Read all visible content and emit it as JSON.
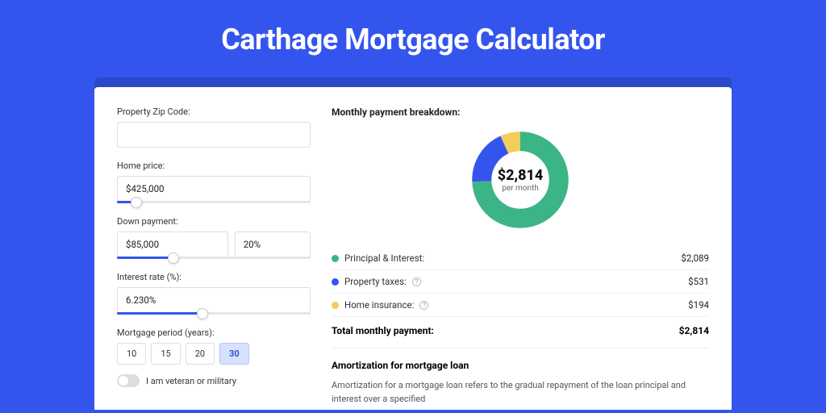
{
  "page_title": "Carthage Mortgage Calculator",
  "form": {
    "zip_label": "Property Zip Code:",
    "zip_value": "",
    "home_price_label": "Home price:",
    "home_price_value": "$425,000",
    "home_price_slider_pct": 10,
    "down_payment_label": "Down payment:",
    "down_payment_value": "$85,000",
    "down_payment_pct_value": "20%",
    "down_payment_slider_pct": 29,
    "interest_label": "Interest rate (%):",
    "interest_value": "6.230%",
    "interest_slider_pct": 44,
    "period_label": "Mortgage period (years):",
    "periods": [
      "10",
      "15",
      "20",
      "30"
    ],
    "period_active": "30",
    "veteran_label": "I am veteran or military"
  },
  "breakdown": {
    "title": "Monthly payment breakdown:",
    "center_amount": "$2,814",
    "center_sub": "per month",
    "items": [
      {
        "label": "Principal & Interest:",
        "value": "$2,089",
        "color": "#3cb586",
        "has_info": false
      },
      {
        "label": "Property taxes:",
        "value": "$531",
        "color": "#3355ee",
        "has_info": true
      },
      {
        "label": "Home insurance:",
        "value": "$194",
        "color": "#f2cd5c",
        "has_info": true
      }
    ],
    "total_label": "Total monthly payment:",
    "total_value": "$2,814"
  },
  "chart_data": {
    "type": "pie",
    "title": "Monthly payment breakdown",
    "series": [
      {
        "name": "Principal & Interest",
        "value": 2089,
        "color": "#3cb586"
      },
      {
        "name": "Property taxes",
        "value": 531,
        "color": "#3355ee"
      },
      {
        "name": "Home insurance",
        "value": 194,
        "color": "#f2cd5c"
      }
    ],
    "total": 2814,
    "center_label": "$2,814 per month"
  },
  "amortization": {
    "title": "Amortization for mortgage loan",
    "text": "Amortization for a mortgage loan refers to the gradual repayment of the loan principal and interest over a specified"
  }
}
